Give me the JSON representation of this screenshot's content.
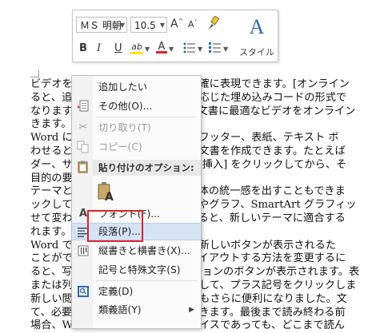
{
  "document": {
    "lines": [
      "ビデオを使うと、伝えたい内容を明確に表現できます。[オンライン",
      "ると、追加したいビデオを、それに応じた埋め込みコードの形式で",
      "なります。キーワードを入力して、文書に最適なビデオをオンライン",
      "きます。",
      "Word に用意されているヘッダー、フッター、表紙、テキスト ボ",
      "わせると、プロのような仕上がりの文書を作成できます。たとえば",
      "ダー、サイドバーを追加できます。[挿入] をクリックしてから、そ",
      "目的の要素を選びます。",
      "テーマとスタイルを使って、文書全体の統一感を出すこともできま",
      "ックして新しいテーマを選ぶと、図やグラフ、SmartArt グラフィッ",
      "せて変わります。スタイルを適用すると、新しいテーマに適合する",
      "れます。",
      "Word では、必要に応じてその場に新しいボタンが表示されるた",
      "ことができます。文書内に写真をレイアウトする方法を変更するに",
      "ると、写真の横にレイアウト オプションのボタンが表示されます。表",
      "または列を追加する場所をクリックして、プラス記号をクリックしま",
      "新しい閲覧ビューが導入され、閲覧もさらに便利になりました。文",
      "て、必要な箇所に集中することができます。最後まで読み終わる前",
      "場合、Word では、たとえ別のデバイスであっても、どこまで読ん"
    ]
  },
  "toolbar": {
    "font_name": "ＭＳ 明朝",
    "font_size": "10.5",
    "grow_font": "A",
    "shrink_font": "A",
    "bold": "B",
    "italic": "I",
    "underline": "U",
    "highlight_letter": "ab",
    "font_color_letter": "A",
    "style_label": "スタイル",
    "style_glyph": "A",
    "accent_color": "#2e67b1",
    "highlight_color": "#ffe500",
    "font_color": "#e0202a"
  },
  "menu": {
    "items": [
      {
        "label": "追加したい",
        "enabled": true
      },
      {
        "label": "その他(O)...",
        "enabled": true
      },
      {
        "label": "切り取り(T)",
        "enabled": false
      },
      {
        "label": "コピー(C)",
        "enabled": false
      },
      {
        "label": "貼り付けのオプション:",
        "enabled": true
      },
      {
        "label": "フォント(F)...",
        "enabled": true
      },
      {
        "label": "段落(P)...",
        "enabled": true
      },
      {
        "label": "縦書きと横書き(X)...",
        "enabled": true
      },
      {
        "label": "記号と特殊文字(S)",
        "enabled": true
      },
      {
        "label": "定義(D)",
        "enabled": true
      },
      {
        "label": "類義語(Y)",
        "enabled": true
      }
    ],
    "submenu_arrow": "▶",
    "highlight_color": "#d5e3f5",
    "annotation_color": "#e0202a"
  }
}
